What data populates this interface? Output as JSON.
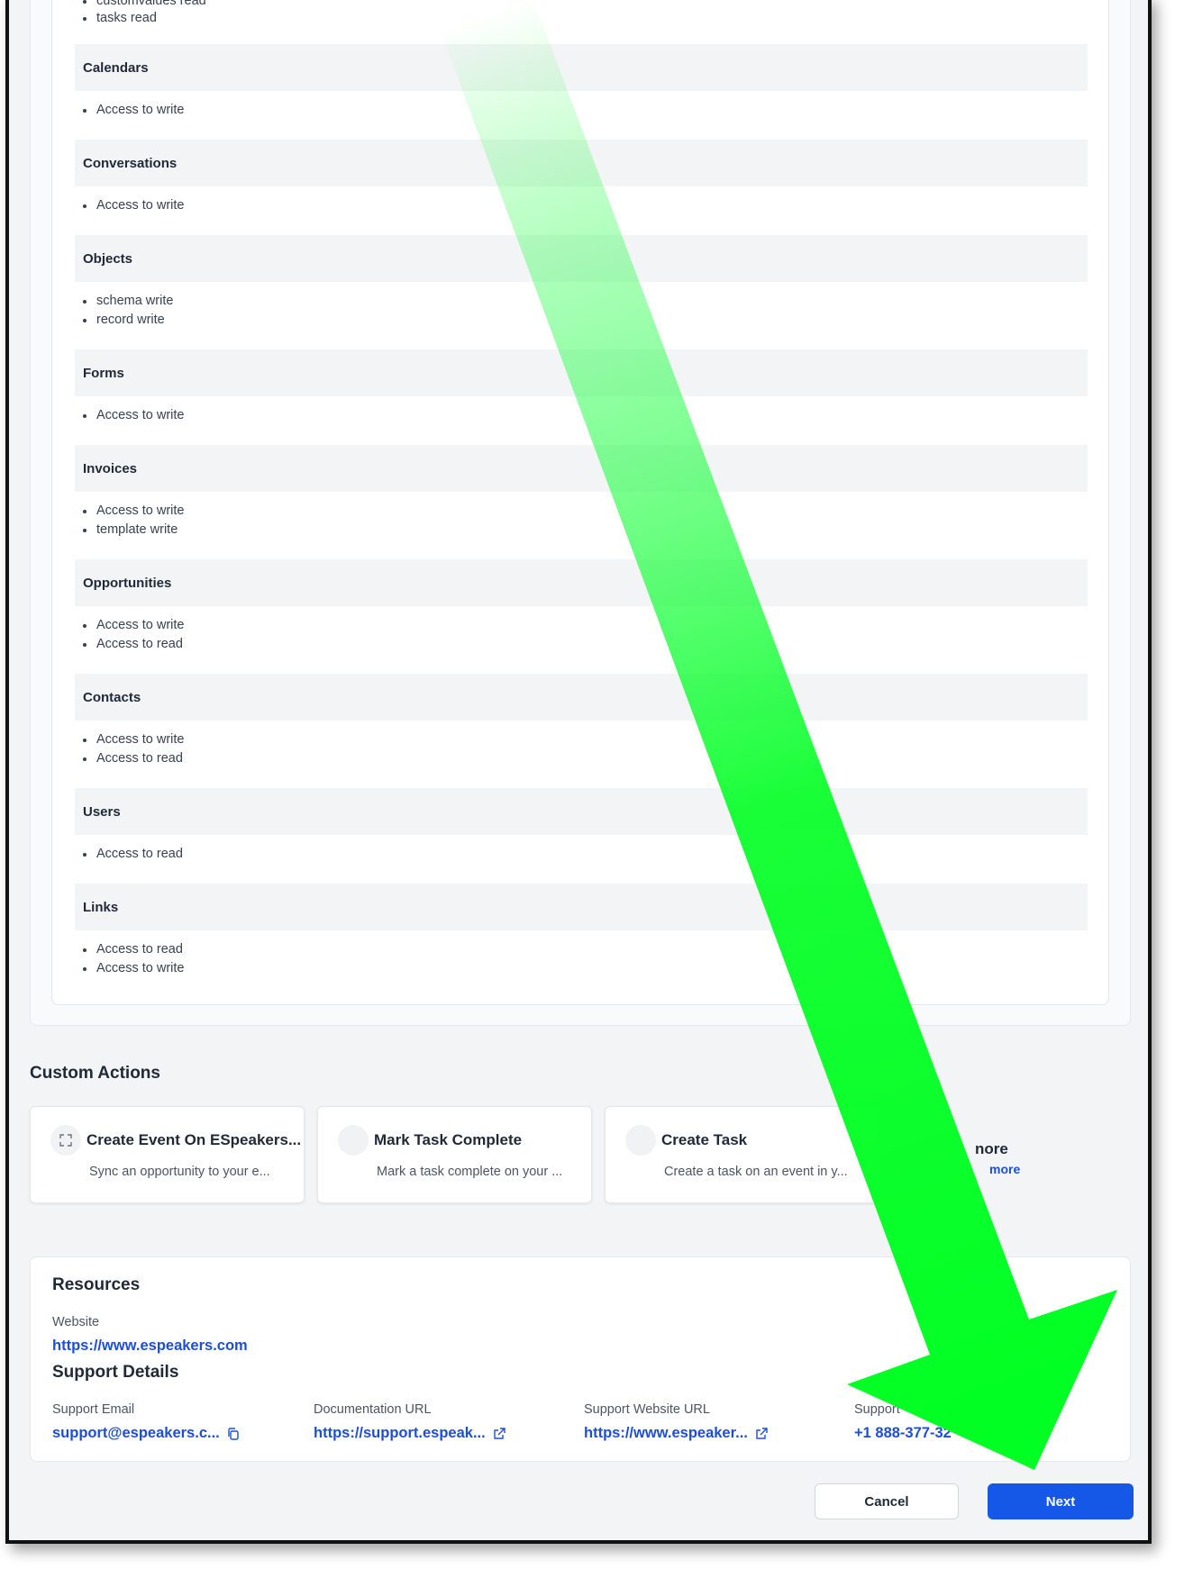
{
  "scopes": {
    "top_items": [
      "customvalues read",
      "tasks read"
    ],
    "groups": [
      {
        "title": "Calendars",
        "items": [
          "Access to write"
        ]
      },
      {
        "title": "Conversations",
        "items": [
          "Access to write"
        ]
      },
      {
        "title": "Objects",
        "items": [
          "schema write",
          "record write"
        ]
      },
      {
        "title": "Forms",
        "items": [
          "Access to write"
        ]
      },
      {
        "title": "Invoices",
        "items": [
          "Access to write",
          "template write"
        ]
      },
      {
        "title": "Opportunities",
        "items": [
          "Access to write",
          "Access to read"
        ]
      },
      {
        "title": "Contacts",
        "items": [
          "Access to write",
          "Access to read"
        ]
      },
      {
        "title": "Users",
        "items": [
          "Access to read"
        ]
      },
      {
        "title": "Links",
        "items": [
          "Access to read",
          "Access to write"
        ]
      }
    ]
  },
  "custom_actions": {
    "title": "Custom Actions",
    "cards": [
      {
        "title": "Create Event On ESpeakers...",
        "desc": "Sync an opportunity to your e...",
        "icon": "expand-icon"
      },
      {
        "title": "Mark Task Complete",
        "desc": "Mark a task complete on your ...",
        "icon": "placeholder-icon"
      },
      {
        "title": "Create Task",
        "desc": "Create a task on an event in y...",
        "icon": "placeholder-icon"
      }
    ],
    "more_title": "nore",
    "more_link": "more"
  },
  "resources": {
    "title": "Resources",
    "website_label": "Website",
    "website_url": "https://www.espeakers.com",
    "support_title": "Support Details",
    "support_email_label": "Support Email",
    "support_email": "support@espeakers.c...",
    "documentation_label": "Documentation URL",
    "documentation_url": "https://support.espeak...",
    "support_website_label": "Support Website URL",
    "support_website_url": "https://www.espeaker...",
    "support_phone_label": "Support",
    "support_phone": "+1 888-377-32"
  },
  "footer": {
    "cancel_label": "Cancel",
    "next_label": "Next"
  },
  "colors": {
    "accent": "#1558e8",
    "link": "#1d4ed8",
    "arrow": "#00ff22"
  }
}
